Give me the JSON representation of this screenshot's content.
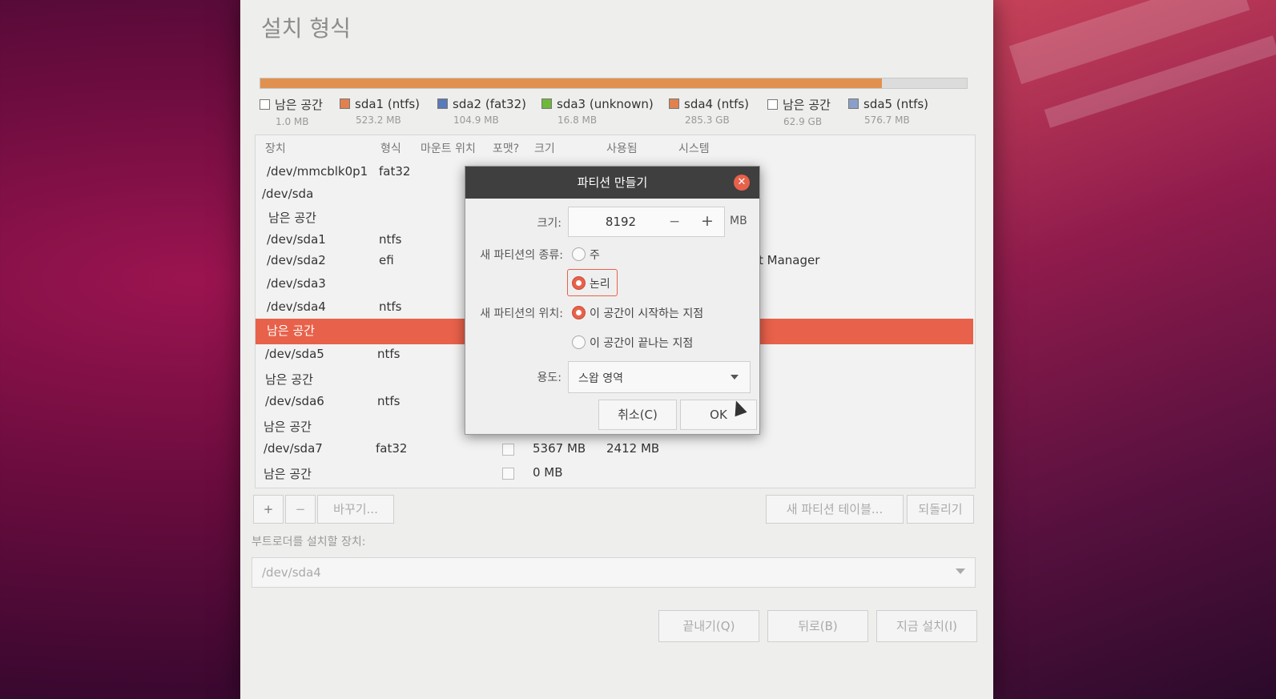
{
  "window": {
    "title": "설치 형식",
    "legend": [
      {
        "name": "남은 공간",
        "size": "1.0 MB",
        "color": "#ffffff"
      },
      {
        "name": "sda1 (ntfs)",
        "size": "523.2 MB",
        "color": "#e0814f"
      },
      {
        "name": "sda2 (fat32)",
        "size": "104.9 MB",
        "color": "#5a7ab8"
      },
      {
        "name": "sda3 (unknown)",
        "size": "16.8 MB",
        "color": "#6fb83a"
      },
      {
        "name": "sda4 (ntfs)",
        "size": "285.3 GB",
        "color": "#e0814f"
      },
      {
        "name": "남은 공간",
        "size": "62.9 GB",
        "color": "#ffffff"
      },
      {
        "name": "sda5 (ntfs)",
        "size": "576.7 MB",
        "color": "#8aa0c8"
      }
    ],
    "usage_bar_fraction": 0.88,
    "table": {
      "headers": {
        "device": "장치",
        "type": "형식",
        "mount": "마운트 위치",
        "format": "포맷?",
        "size": "크기",
        "used": "사용됨",
        "system": "시스템"
      },
      "rows": [
        {
          "device": "/dev/mmcblk0p1",
          "type": "fat32"
        },
        {
          "device": "/dev/sda",
          "type": ""
        },
        {
          "device": "남은 공간",
          "type": ""
        },
        {
          "device": "/dev/sda1",
          "type": "ntfs"
        },
        {
          "device": "/dev/sda2",
          "type": "efi",
          "system": "t Manager"
        },
        {
          "device": "/dev/sda3",
          "type": ""
        },
        {
          "device": "/dev/sda4",
          "type": "ntfs"
        },
        {
          "device": "남은 공간",
          "type": "",
          "selected": true
        },
        {
          "device": "/dev/sda5",
          "type": "ntfs"
        },
        {
          "device": "남은 공간",
          "type": ""
        },
        {
          "device": "/dev/sda6",
          "type": "ntfs"
        },
        {
          "device": "남은 공간",
          "type": ""
        },
        {
          "device": "/dev/sda7",
          "type": "fat32",
          "size": "5367 MB",
          "used": "2412 MB"
        },
        {
          "device": "남은 공간",
          "type": "",
          "size": "0 MB"
        }
      ]
    },
    "toolbar": {
      "add": "+",
      "remove": "−",
      "change": "바꾸기...",
      "new_table": "새 파티션 테이블...",
      "revert": "되돌리기"
    },
    "bootloader_label": "부트로더를 설치할 장치:",
    "bootloader_value": "/dev/sda4",
    "buttons": {
      "quit": "끝내기(Q)",
      "back": "뒤로(B)",
      "install": "지금 설치(I)"
    }
  },
  "dialog": {
    "title": "파티션 만들기",
    "size_label": "크기:",
    "size_value": "8192",
    "size_unit": "MB",
    "type_label": "새 파티션의 종류:",
    "type_primary": "주",
    "type_logical": "논리",
    "location_label": "새 파티션의 위치:",
    "location_start": "이 공간이 시작하는 지점",
    "location_end": "이 공간이 끝나는 지점",
    "use_label": "용도:",
    "use_value": "스왑 영역",
    "cancel": "취소(C)",
    "ok": "OK"
  }
}
